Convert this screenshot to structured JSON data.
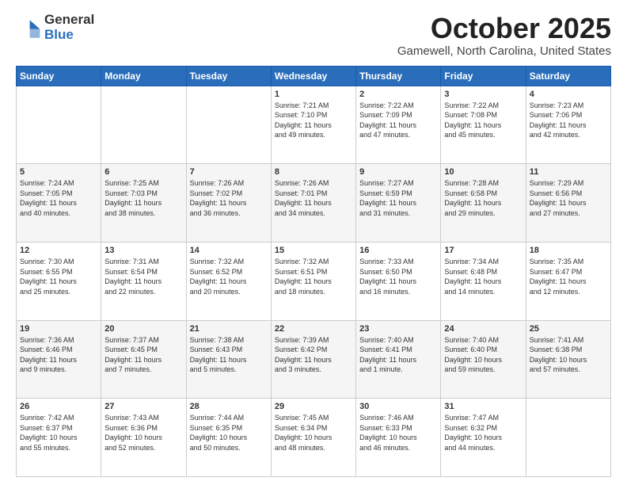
{
  "header": {
    "logo_general": "General",
    "logo_blue": "Blue",
    "month_title": "October 2025",
    "location": "Gamewell, North Carolina, United States"
  },
  "days_of_week": [
    "Sunday",
    "Monday",
    "Tuesday",
    "Wednesday",
    "Thursday",
    "Friday",
    "Saturday"
  ],
  "weeks": [
    [
      {
        "day": "",
        "info": ""
      },
      {
        "day": "",
        "info": ""
      },
      {
        "day": "",
        "info": ""
      },
      {
        "day": "1",
        "info": "Sunrise: 7:21 AM\nSunset: 7:10 PM\nDaylight: 11 hours\nand 49 minutes."
      },
      {
        "day": "2",
        "info": "Sunrise: 7:22 AM\nSunset: 7:09 PM\nDaylight: 11 hours\nand 47 minutes."
      },
      {
        "day": "3",
        "info": "Sunrise: 7:22 AM\nSunset: 7:08 PM\nDaylight: 11 hours\nand 45 minutes."
      },
      {
        "day": "4",
        "info": "Sunrise: 7:23 AM\nSunset: 7:06 PM\nDaylight: 11 hours\nand 42 minutes."
      }
    ],
    [
      {
        "day": "5",
        "info": "Sunrise: 7:24 AM\nSunset: 7:05 PM\nDaylight: 11 hours\nand 40 minutes."
      },
      {
        "day": "6",
        "info": "Sunrise: 7:25 AM\nSunset: 7:03 PM\nDaylight: 11 hours\nand 38 minutes."
      },
      {
        "day": "7",
        "info": "Sunrise: 7:26 AM\nSunset: 7:02 PM\nDaylight: 11 hours\nand 36 minutes."
      },
      {
        "day": "8",
        "info": "Sunrise: 7:26 AM\nSunset: 7:01 PM\nDaylight: 11 hours\nand 34 minutes."
      },
      {
        "day": "9",
        "info": "Sunrise: 7:27 AM\nSunset: 6:59 PM\nDaylight: 11 hours\nand 31 minutes."
      },
      {
        "day": "10",
        "info": "Sunrise: 7:28 AM\nSunset: 6:58 PM\nDaylight: 11 hours\nand 29 minutes."
      },
      {
        "day": "11",
        "info": "Sunrise: 7:29 AM\nSunset: 6:56 PM\nDaylight: 11 hours\nand 27 minutes."
      }
    ],
    [
      {
        "day": "12",
        "info": "Sunrise: 7:30 AM\nSunset: 6:55 PM\nDaylight: 11 hours\nand 25 minutes."
      },
      {
        "day": "13",
        "info": "Sunrise: 7:31 AM\nSunset: 6:54 PM\nDaylight: 11 hours\nand 22 minutes."
      },
      {
        "day": "14",
        "info": "Sunrise: 7:32 AM\nSunset: 6:52 PM\nDaylight: 11 hours\nand 20 minutes."
      },
      {
        "day": "15",
        "info": "Sunrise: 7:32 AM\nSunset: 6:51 PM\nDaylight: 11 hours\nand 18 minutes."
      },
      {
        "day": "16",
        "info": "Sunrise: 7:33 AM\nSunset: 6:50 PM\nDaylight: 11 hours\nand 16 minutes."
      },
      {
        "day": "17",
        "info": "Sunrise: 7:34 AM\nSunset: 6:48 PM\nDaylight: 11 hours\nand 14 minutes."
      },
      {
        "day": "18",
        "info": "Sunrise: 7:35 AM\nSunset: 6:47 PM\nDaylight: 11 hours\nand 12 minutes."
      }
    ],
    [
      {
        "day": "19",
        "info": "Sunrise: 7:36 AM\nSunset: 6:46 PM\nDaylight: 11 hours\nand 9 minutes."
      },
      {
        "day": "20",
        "info": "Sunrise: 7:37 AM\nSunset: 6:45 PM\nDaylight: 11 hours\nand 7 minutes."
      },
      {
        "day": "21",
        "info": "Sunrise: 7:38 AM\nSunset: 6:43 PM\nDaylight: 11 hours\nand 5 minutes."
      },
      {
        "day": "22",
        "info": "Sunrise: 7:39 AM\nSunset: 6:42 PM\nDaylight: 11 hours\nand 3 minutes."
      },
      {
        "day": "23",
        "info": "Sunrise: 7:40 AM\nSunset: 6:41 PM\nDaylight: 11 hours\nand 1 minute."
      },
      {
        "day": "24",
        "info": "Sunrise: 7:40 AM\nSunset: 6:40 PM\nDaylight: 10 hours\nand 59 minutes."
      },
      {
        "day": "25",
        "info": "Sunrise: 7:41 AM\nSunset: 6:38 PM\nDaylight: 10 hours\nand 57 minutes."
      }
    ],
    [
      {
        "day": "26",
        "info": "Sunrise: 7:42 AM\nSunset: 6:37 PM\nDaylight: 10 hours\nand 55 minutes."
      },
      {
        "day": "27",
        "info": "Sunrise: 7:43 AM\nSunset: 6:36 PM\nDaylight: 10 hours\nand 52 minutes."
      },
      {
        "day": "28",
        "info": "Sunrise: 7:44 AM\nSunset: 6:35 PM\nDaylight: 10 hours\nand 50 minutes."
      },
      {
        "day": "29",
        "info": "Sunrise: 7:45 AM\nSunset: 6:34 PM\nDaylight: 10 hours\nand 48 minutes."
      },
      {
        "day": "30",
        "info": "Sunrise: 7:46 AM\nSunset: 6:33 PM\nDaylight: 10 hours\nand 46 minutes."
      },
      {
        "day": "31",
        "info": "Sunrise: 7:47 AM\nSunset: 6:32 PM\nDaylight: 10 hours\nand 44 minutes."
      },
      {
        "day": "",
        "info": ""
      }
    ]
  ]
}
